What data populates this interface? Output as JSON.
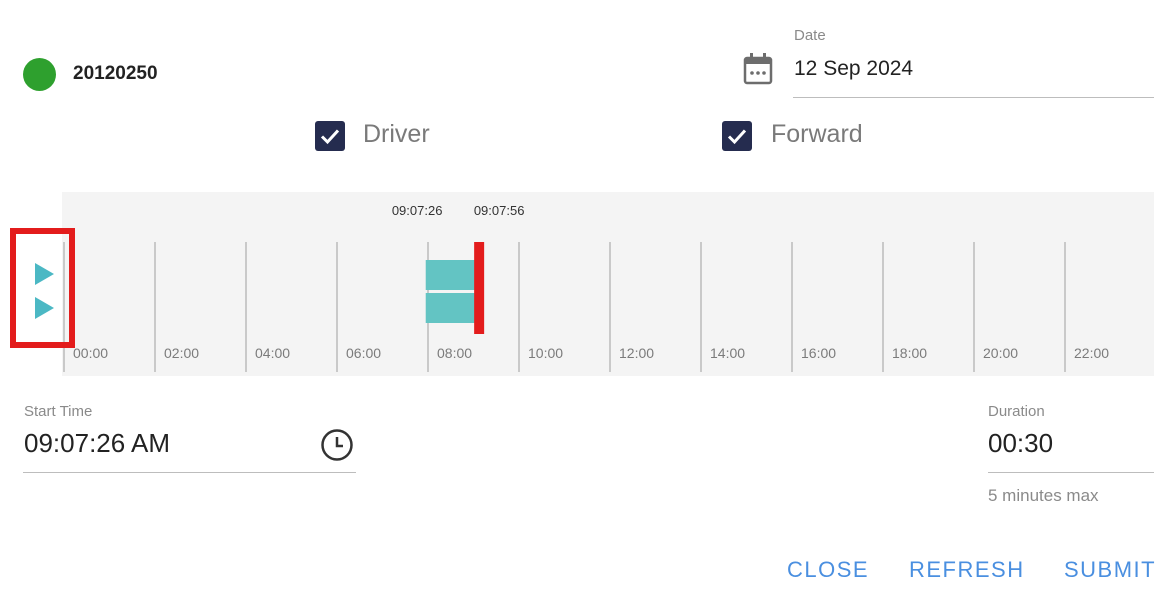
{
  "vehicle": {
    "id": "20120250",
    "status_color": "#2ea02e",
    "status_icon": "status-dot"
  },
  "date": {
    "label": "Date",
    "value": "12 Sep 2024",
    "icon": "calendar-icon"
  },
  "filters": {
    "driver": {
      "label": "Driver",
      "checked": true
    },
    "forward": {
      "label": "Forward",
      "checked": true
    }
  },
  "timeline": {
    "ticks": [
      "00:00",
      "02:00",
      "04:00",
      "06:00",
      "08:00",
      "10:00",
      "12:00",
      "14:00",
      "16:00",
      "18:00",
      "20:00",
      "22:00"
    ],
    "range_hours": [
      0,
      24
    ],
    "selection": {
      "start_label": "09:07:26",
      "end_label": "09:07:56"
    },
    "segments": [
      {
        "name": "driver-footage",
        "start_hour": 7.95,
        "end_hour": 9.15,
        "color": "#63c4c3"
      },
      {
        "name": "forward-footage",
        "start_hour": 7.95,
        "end_hour": 9.15,
        "color": "#63c4c3"
      }
    ],
    "marker_hour": 9.124,
    "marker_color": "#e31c1c",
    "controls": [
      "play-driver",
      "play-forward"
    ]
  },
  "start_time": {
    "label": "Start Time",
    "value": "09:07:26 AM",
    "icon": "clock-icon"
  },
  "duration": {
    "label": "Duration",
    "value": "00:30",
    "hint": "5 minutes max"
  },
  "actions": {
    "close": "CLOSE",
    "refresh": "REFRESH",
    "submit": "SUBMIT"
  },
  "colors": {
    "accent": "#4a8fe0",
    "checkbox": "#252c4f",
    "highlight": "#e31c1c"
  }
}
